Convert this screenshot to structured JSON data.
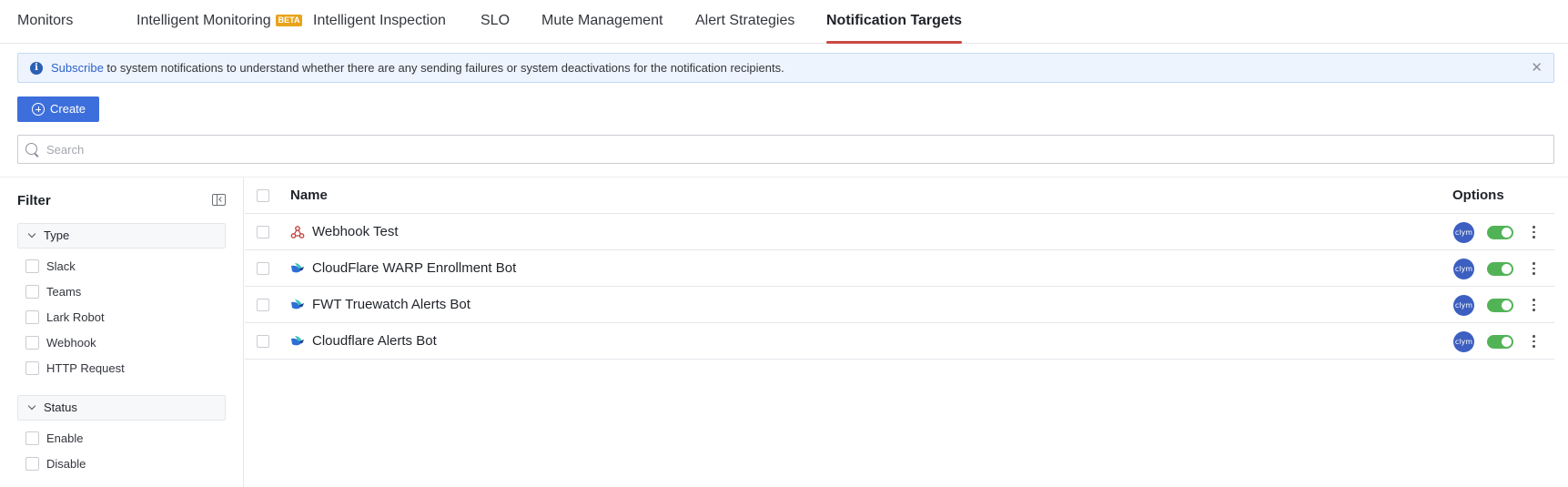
{
  "tabs": [
    {
      "label": "Monitors",
      "active": false
    },
    {
      "label": "Intelligent Monitoring",
      "badge": "BETA",
      "active": false
    },
    {
      "label": "Intelligent Inspection",
      "active": false
    },
    {
      "label": "SLO",
      "active": false
    },
    {
      "label": "Mute Management",
      "active": false
    },
    {
      "label": "Alert Strategies",
      "active": false
    },
    {
      "label": "Notification Targets",
      "active": true
    }
  ],
  "notice": {
    "link_text": "Subscribe",
    "text": " to system notifications to understand whether there are any sending failures or system deactivations for the notification recipients.",
    "close": "✕"
  },
  "toolbar": {
    "create_label": "Create"
  },
  "search": {
    "placeholder": "Search",
    "value": ""
  },
  "filter": {
    "title": "Filter",
    "groups": [
      {
        "label": "Type",
        "options": [
          "Slack",
          "Teams",
          "Lark Robot",
          "Webhook",
          "HTTP Request"
        ]
      },
      {
        "label": "Status",
        "options": [
          "Enable",
          "Disable"
        ]
      }
    ]
  },
  "table": {
    "columns": {
      "name": "Name",
      "options": "Options"
    },
    "rows": [
      {
        "name": "Webhook Test",
        "type_icon": "webhook-icon",
        "avatar": "clym",
        "enabled": true
      },
      {
        "name": "CloudFlare WARP Enrollment Bot",
        "type_icon": "lark-bot-icon",
        "avatar": "clym",
        "enabled": true
      },
      {
        "name": "FWT Truewatch Alerts Bot",
        "type_icon": "lark-bot-icon",
        "avatar": "clym",
        "enabled": true
      },
      {
        "name": "Cloudflare Alerts Bot",
        "type_icon": "lark-bot-icon",
        "avatar": "clym",
        "enabled": true
      }
    ]
  },
  "colors": {
    "accent": "#3d6fdc",
    "tab_underline": "#c94a43",
    "toggle_on": "#52b356",
    "beta_badge": "#e8a31b",
    "avatar": "#3c5fc1"
  }
}
